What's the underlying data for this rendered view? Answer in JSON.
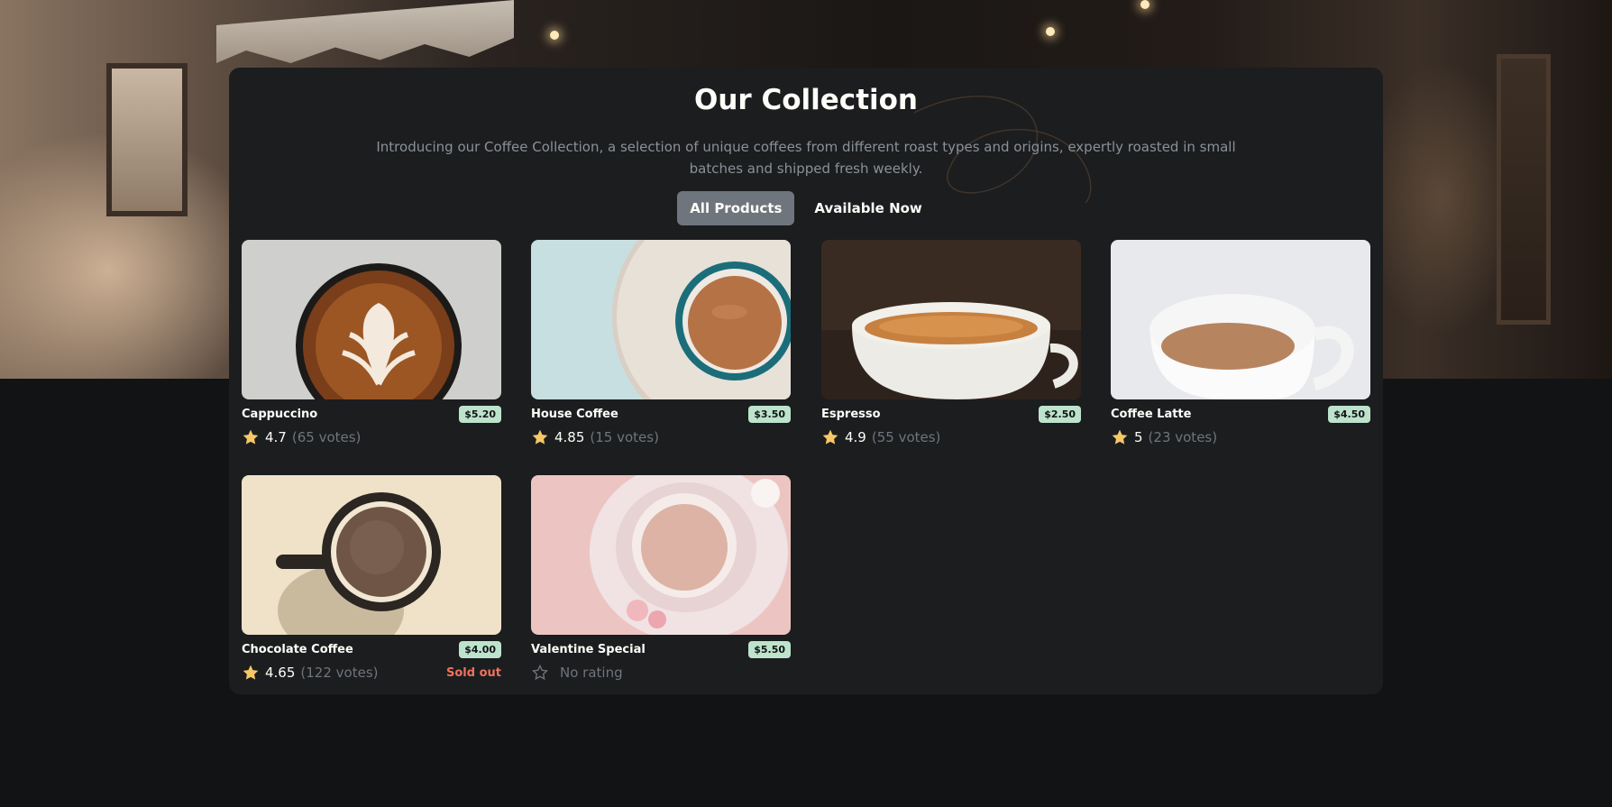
{
  "collection": {
    "title": "Our Collection",
    "description": "Introducing our Coffee Collection, a selection of unique coffees from different roast types and origins, expertly roasted in small batches and shipped fresh weekly."
  },
  "filters": [
    {
      "label": "All Products",
      "active": true
    },
    {
      "label": "Available Now",
      "active": false
    }
  ],
  "products": [
    {
      "name": "Cappuccino",
      "price": "$5.20",
      "rating": "4.7",
      "votes": "(65 votes)"
    },
    {
      "name": "House Coffee",
      "price": "$3.50",
      "rating": "4.85",
      "votes": "(15 votes)"
    },
    {
      "name": "Espresso",
      "price": "$2.50",
      "rating": "4.9",
      "votes": "(55 votes)"
    },
    {
      "name": "Coffee Latte",
      "price": "$4.50",
      "rating": "5",
      "votes": "(23 votes)"
    },
    {
      "name": "Chocolate Coffee",
      "price": "$4.00",
      "rating": "4.65",
      "votes": "(122 votes)",
      "status": "Sold out"
    },
    {
      "name": "Valentine Special",
      "price": "$5.50",
      "no_rating": "No rating"
    }
  ],
  "colors": {
    "background": "#111315",
    "panel": "#1b1d1f",
    "active_filter": "#6f757c",
    "price_badge": "#bee3cc",
    "star": "#f6c768",
    "sold_out": "#ed735d",
    "muted_text": "#6f757c"
  },
  "icons": {
    "rated": "star-filled-icon",
    "unrated": "star-outline-icon"
  }
}
